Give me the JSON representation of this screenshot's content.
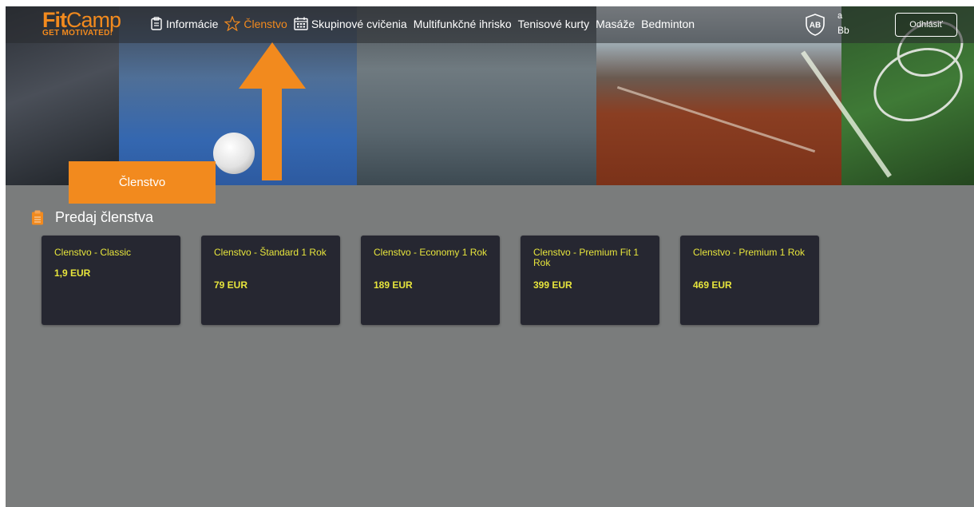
{
  "brand": {
    "name_part1": "Fit",
    "name_part2": "Camp",
    "tagline": "GET MOTIVATED!"
  },
  "nav": {
    "items": [
      {
        "label": "Informácie",
        "icon": "clipboard-icon"
      },
      {
        "label": "Členstvo",
        "icon": "star-icon",
        "active": true
      },
      {
        "label": "Skupinové cvičenia",
        "icon": "calendar-icon"
      },
      {
        "label": "Multifunkčné ihrisko"
      },
      {
        "label": "Tenisové kurty"
      },
      {
        "label": "Masáže"
      },
      {
        "label": "Bedminton"
      }
    ]
  },
  "user": {
    "initials": "AB",
    "line1": "a",
    "line2": "Bb",
    "logout_label": "Odhlásiť"
  },
  "overlay": {
    "callout_label": "Členstvo"
  },
  "section": {
    "title": "Predaj členstva",
    "icon": "clipboard-icon"
  },
  "memberships": [
    {
      "name": "Clenstvo - Classic",
      "price": "1,9 EUR"
    },
    {
      "name": "Clenstvo - Štandard 1 Rok",
      "price": "79 EUR"
    },
    {
      "name": "Clenstvo - Economy 1 Rok",
      "price": "189 EUR"
    },
    {
      "name": "Clenstvo - Premium Fit 1 Rok",
      "price": "399 EUR"
    },
    {
      "name": "Clenstvo - Premium 1 Rok",
      "price": "469 EUR"
    }
  ],
  "colors": {
    "accent": "#f28a1e",
    "card_bg": "#262731",
    "card_text": "#e7e53c",
    "page_bg": "#7a7c7c"
  }
}
